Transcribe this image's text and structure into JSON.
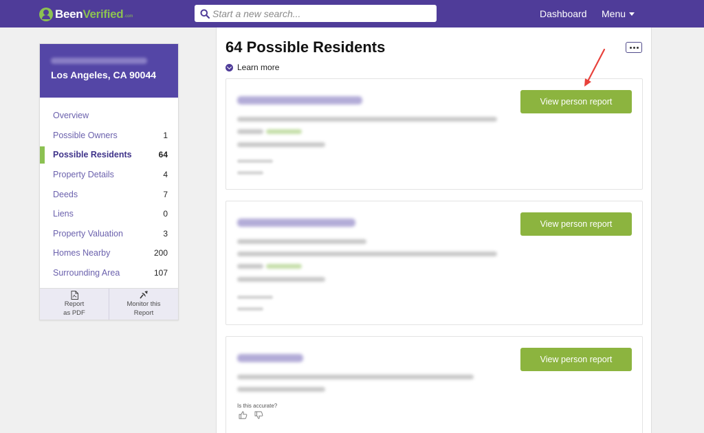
{
  "header": {
    "logo": {
      "been": "Been",
      "verified": "Verified",
      "com": ".com"
    },
    "search_placeholder": "Start a new search...",
    "nav": {
      "dashboard": "Dashboard",
      "menu": "Menu"
    }
  },
  "sidebar": {
    "address": "Los Angeles, CA 90044",
    "items": [
      {
        "label": "Overview",
        "count": ""
      },
      {
        "label": "Possible Owners",
        "count": "1"
      },
      {
        "label": "Possible Residents",
        "count": "64",
        "active": true
      },
      {
        "label": "Property Details",
        "count": "4"
      },
      {
        "label": "Deeds",
        "count": "7"
      },
      {
        "label": "Liens",
        "count": "0"
      },
      {
        "label": "Property Valuation",
        "count": "3"
      },
      {
        "label": "Homes Nearby",
        "count": "200"
      },
      {
        "label": "Surrounding Area",
        "count": "107"
      }
    ],
    "footer": {
      "report_pdf": {
        "line1": "Report",
        "line2": "as PDF"
      },
      "monitor": {
        "line1": "Monitor this",
        "line2": "Report"
      }
    }
  },
  "main": {
    "title": "64 Possible Residents",
    "learn_more": "Learn more",
    "results": [
      {
        "button": "View person report"
      },
      {
        "button": "View person report"
      },
      {
        "button": "View person report",
        "accurate_prompt": "Is this accurate?"
      }
    ]
  },
  "colors": {
    "brand_purple": "#4f3c99",
    "brand_green": "#8cc152",
    "button_green": "#8cb43f",
    "annotation_red": "#e8413b"
  }
}
